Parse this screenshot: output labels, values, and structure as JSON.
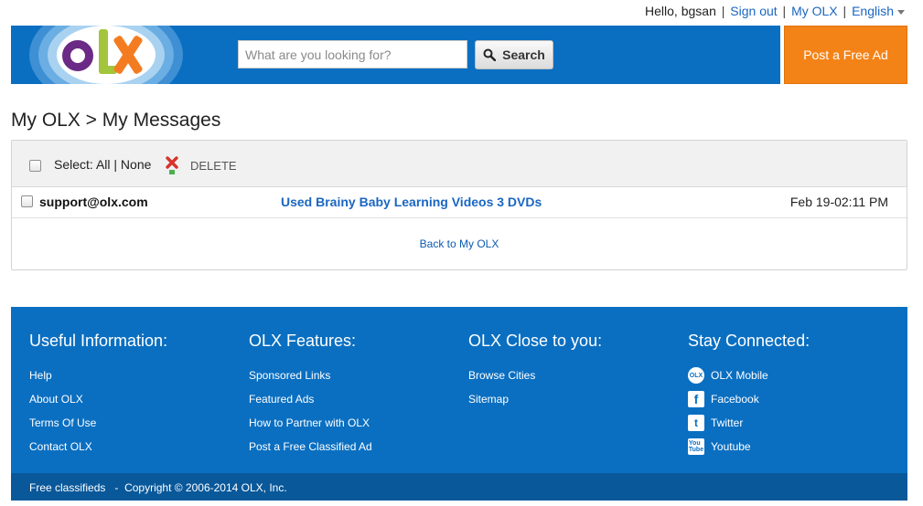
{
  "userbar": {
    "greeting": "Hello, bgsan",
    "sign_out": "Sign out",
    "my_olx": "My OLX",
    "language": "English"
  },
  "header": {
    "search_placeholder": "What are you looking for?",
    "search_button": "Search",
    "post_ad": "Post a Free Ad"
  },
  "page": {
    "title": "My OLX > My Messages"
  },
  "messages": {
    "select_label": "Select:",
    "select_all": "All",
    "select_none": "None",
    "delete_label": "DELETE",
    "rows": [
      {
        "sender": "support@olx.com",
        "subject": "Used Brainy Baby Learning Videos 3 DVDs",
        "date": "Feb 19-02:11 PM"
      }
    ],
    "back_link": "Back to My OLX"
  },
  "footer": {
    "columns": [
      {
        "title": "Useful Information:",
        "links": [
          "Help",
          "About OLX",
          "Terms Of Use",
          "Contact OLX"
        ]
      },
      {
        "title": "OLX Features:",
        "links": [
          "Sponsored Links",
          "Featured Ads",
          "How to Partner with OLX",
          "Post a Free Classified Ad"
        ]
      },
      {
        "title": "OLX Close to you:",
        "links": [
          "Browse Cities",
          "Sitemap"
        ]
      },
      {
        "title": "Stay Connected:",
        "links": [
          "OLX Mobile",
          "Facebook",
          "Twitter",
          "Youtube"
        ]
      }
    ],
    "bottom_left": "Free classifieds",
    "bottom_sep": "-",
    "copyright": "Copyright © 2006-2014 OLX, Inc."
  },
  "colors": {
    "header_blue": "#0a6fc1",
    "post_ad_orange": "#f48317",
    "link_blue": "#1a66c2"
  },
  "icons": [
    "olx-logo",
    "search-icon",
    "delete-icon",
    "olx-mobile-icon",
    "facebook-icon",
    "twitter-icon",
    "youtube-icon",
    "caret-down-icon"
  ]
}
